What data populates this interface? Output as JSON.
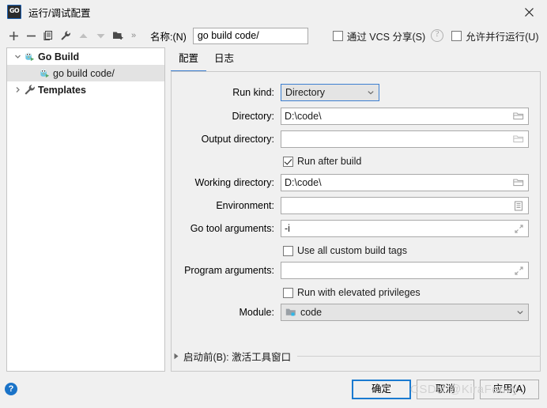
{
  "window": {
    "title": "运行/调试配置",
    "app_icon": "go-icon",
    "close_label": "×"
  },
  "toolbar": {
    "buttons": [
      {
        "name": "add-button",
        "icon": "plus-icon",
        "enabled": true
      },
      {
        "name": "remove-button",
        "icon": "minus-icon",
        "enabled": true
      },
      {
        "name": "copy-button",
        "icon": "copy-icon",
        "enabled": true
      },
      {
        "name": "edit-templates-button",
        "icon": "wrench-icon",
        "enabled": true
      },
      {
        "name": "move-up-button",
        "icon": "arrow-up-icon",
        "enabled": false
      },
      {
        "name": "move-down-button",
        "icon": "arrow-down-icon",
        "enabled": false
      },
      {
        "name": "move-into-folder-button",
        "icon": "folder-add-icon",
        "enabled": true
      },
      {
        "name": "overflow-button",
        "icon": "chevrons-right-icon",
        "enabled": true
      }
    ],
    "name_label": "名称:(N)",
    "name_value": "go build code/",
    "name_placeholder": "",
    "share_vcs_label": "通过 VCS 分享(S)",
    "share_vcs_checked": false,
    "share_vcs_help": "?",
    "allow_parallel_label": "允许并行运行(U)",
    "allow_parallel_checked": false
  },
  "tree": {
    "items": [
      {
        "label": "Go Build",
        "level": 0,
        "expanded": true,
        "icon": "go-build-icon",
        "selected": false,
        "bold": true
      },
      {
        "label": "go build code/",
        "level": 1,
        "icon": "go-build-icon",
        "selected": true,
        "bold": false
      },
      {
        "label": "Templates",
        "level": 0,
        "expanded": false,
        "icon": "wrench-icon",
        "selected": false,
        "bold": true
      }
    ]
  },
  "tabs": [
    {
      "label": "配置",
      "active": true
    },
    {
      "label": "日志",
      "active": false
    }
  ],
  "form": {
    "run_kind": {
      "label": "Run kind:",
      "value": "Directory"
    },
    "directory": {
      "label": "Directory:",
      "value": "D:\\code\\",
      "icon": "folder-icon"
    },
    "output_directory": {
      "label": "Output directory:",
      "value": "",
      "icon": "folder-icon"
    },
    "run_after_build": {
      "label": "Run after build",
      "checked": true
    },
    "working_directory": {
      "label": "Working directory:",
      "value": "D:\\code\\",
      "icon": "folder-icon"
    },
    "environment": {
      "label": "Environment:",
      "value": "",
      "icon": "list-icon"
    },
    "go_tool_arguments": {
      "label": "Go tool arguments:",
      "value": "-i",
      "icon": "expand-icon"
    },
    "use_all_custom_build_tags": {
      "label": "Use all custom build tags",
      "checked": false
    },
    "program_arguments": {
      "label": "Program arguments:",
      "value": "",
      "icon": "expand-icon"
    },
    "run_with_elevated_privileges": {
      "label": "Run with elevated privileges",
      "checked": false
    },
    "module": {
      "label": "Module:",
      "value": "code",
      "icon": "module-folder-icon"
    }
  },
  "before_launch": {
    "label": "启动前(B): 激活工具窗口"
  },
  "footer": {
    "help": "?",
    "ok": "确定",
    "cancel": "取消",
    "apply": "应用(A)",
    "watermark": "CSDN @KiraFenvy"
  },
  "colors": {
    "accent": "#3d7fd0",
    "dialog_bg": "#f0f0f0",
    "field_bg": "#ffffff",
    "selection": "#e3e3e3"
  }
}
